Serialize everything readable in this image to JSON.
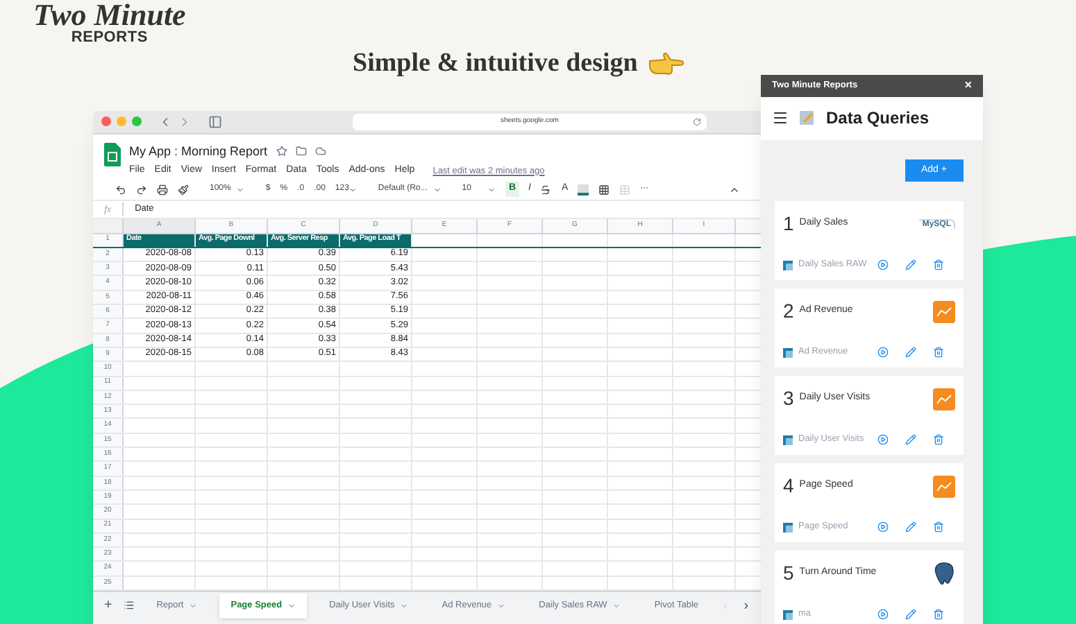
{
  "logo": {
    "line1": "Two Minute",
    "line2": "REPORTS"
  },
  "headline": "Simple & intuitive design",
  "browser": {
    "url": "sheets.google.com"
  },
  "sheet": {
    "title": "My App : Morning Report",
    "menu": [
      "File",
      "Edit",
      "View",
      "Insert",
      "Format",
      "Data",
      "Tools",
      "Add-ons",
      "Help"
    ],
    "last_edit": "Last edit was 2 minutes ago",
    "toolbar": {
      "zoom": "100%",
      "currency": "$",
      "percent": "%",
      "dec_less": ".0",
      "dec_more": ".00",
      "number_format": "123",
      "font": "Default (Ro...",
      "size": "10",
      "bold": "B",
      "bold_active": true,
      "italic": "I",
      "text_color": "A",
      "more": "···"
    },
    "formula": {
      "label": "fx",
      "value": "Date"
    },
    "columns": [
      "A",
      "B",
      "C",
      "D",
      "E",
      "F",
      "G",
      "H",
      "I"
    ],
    "rows": [
      {
        "number": "1",
        "header": true,
        "cells": [
          "Date",
          "Avg. Page Downl",
          "Avg. Server Resp",
          "Avg. Page Load T"
        ]
      },
      {
        "number": "2",
        "header": false,
        "cells": [
          "2020-08-08",
          "0.13",
          "0.39",
          "6.19"
        ]
      },
      {
        "number": "3",
        "header": false,
        "cells": [
          "2020-08-09",
          "0.11",
          "0.50",
          "5.43"
        ]
      },
      {
        "number": "4",
        "header": false,
        "cells": [
          "2020-08-10",
          "0.06",
          "0.32",
          "3.02"
        ]
      },
      {
        "number": "5",
        "header": false,
        "cells": [
          "2020-08-11",
          "0.46",
          "0.58",
          "7.56"
        ]
      },
      {
        "number": "6",
        "header": false,
        "cells": [
          "2020-08-12",
          "0.22",
          "0.38",
          "5.19"
        ]
      },
      {
        "number": "7",
        "header": false,
        "cells": [
          "2020-08-13",
          "0.22",
          "0.54",
          "5.29"
        ]
      },
      {
        "number": "8",
        "header": false,
        "cells": [
          "2020-08-14",
          "0.14",
          "0.33",
          "8.84"
        ]
      },
      {
        "number": "9",
        "header": false,
        "cells": [
          "2020-08-15",
          "0.08",
          "0.51",
          "8.43"
        ]
      },
      {
        "number": "10",
        "header": false,
        "cells": []
      },
      {
        "number": "11",
        "header": false,
        "cells": []
      },
      {
        "number": "12",
        "header": false,
        "cells": []
      },
      {
        "number": "13",
        "header": false,
        "cells": []
      },
      {
        "number": "14",
        "header": false,
        "cells": []
      },
      {
        "number": "15",
        "header": false,
        "cells": []
      },
      {
        "number": "16",
        "header": false,
        "cells": []
      },
      {
        "number": "17",
        "header": false,
        "cells": []
      },
      {
        "number": "18",
        "header": false,
        "cells": []
      },
      {
        "number": "19",
        "header": false,
        "cells": []
      },
      {
        "number": "20",
        "header": false,
        "cells": []
      },
      {
        "number": "21",
        "header": false,
        "cells": []
      },
      {
        "number": "22",
        "header": false,
        "cells": []
      },
      {
        "number": "23",
        "header": false,
        "cells": []
      },
      {
        "number": "24",
        "header": false,
        "cells": []
      },
      {
        "number": "25",
        "header": false,
        "cells": []
      }
    ],
    "add_sheet": "+",
    "tabs": [
      {
        "label": "Report",
        "selected": false
      },
      {
        "label": "Page Speed",
        "selected": true
      },
      {
        "label": "Daily User Visits",
        "selected": false
      },
      {
        "label": "Ad Revenue",
        "selected": false
      },
      {
        "label": "Daily Sales RAW",
        "selected": false
      },
      {
        "label": "Pivot Table",
        "selected": false
      }
    ]
  },
  "panel": {
    "title": "Two Minute Reports",
    "close": "×",
    "heading": "Data Queries",
    "add_button": "Add +",
    "queries": [
      {
        "number": "1",
        "name": "Daily Sales",
        "sheet": "Daily Sales RAW",
        "kind": "mysql",
        "source_label": "MySQL"
      },
      {
        "number": "2",
        "name": "Ad Revenue",
        "sheet": "Ad Revenue",
        "kind": "chart"
      },
      {
        "number": "3",
        "name": "Daily User Visits",
        "sheet": "Daily User Visits",
        "kind": "chart"
      },
      {
        "number": "4",
        "name": "Page Speed",
        "sheet": "Page Speed",
        "kind": "chart"
      },
      {
        "number": "5",
        "name": "Turn Around Time",
        "sheet": "ma",
        "kind": "postgres"
      }
    ]
  }
}
